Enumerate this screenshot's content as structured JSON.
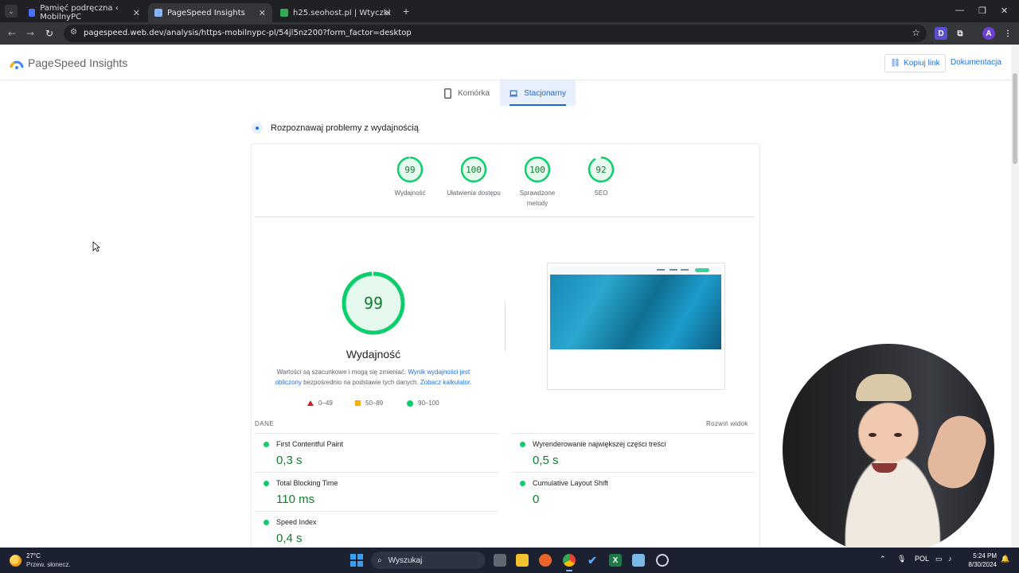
{
  "browser": {
    "tabs": [
      {
        "title": "Pamięć podręczna ‹ MobilnyPC",
        "active": false
      },
      {
        "title": "PageSpeed Insights",
        "active": true
      },
      {
        "title": "h25.seohost.pl | Wtyczki",
        "active": false
      }
    ],
    "url": "pagespeed.web.dev/analysis/https-mobilnypc-pl/54jl5nz200?form_factor=desktop",
    "profile_letter": "A",
    "ext_letter": "D"
  },
  "header": {
    "title": "PageSpeed Insights",
    "copy_link": "Kopiuj link",
    "docs": "Dokumentacja"
  },
  "device_tabs": {
    "mobile": "Komórka",
    "desktop": "Stacjonarny",
    "selected": "desktop"
  },
  "diagnose_heading": "Rozpoznawaj problemy z wydajnością",
  "scores": [
    {
      "value": "99",
      "score": 99,
      "label": "Wydajność"
    },
    {
      "value": "100",
      "score": 100,
      "label": "Ułatwienia dostępu"
    },
    {
      "value": "100",
      "score": 100,
      "label": "Sprawdzone metody"
    },
    {
      "value": "92",
      "score": 92,
      "label": "SEO"
    }
  ],
  "performance": {
    "score": "99",
    "score_value": 99,
    "title": "Wydajność",
    "desc_part1": "Wartości są szacunkowe i mogą się zmieniać. ",
    "desc_link1": "Wynik wydajności jest obliczony",
    "desc_part2": " bezpośrednio na podstawie tych danych. ",
    "desc_link2": "Zobacz kalkulator",
    "desc_part3": "."
  },
  "legend": {
    "bad": "0–49",
    "average": "50–89",
    "good": "90–100"
  },
  "metrics_section": {
    "label": "DANE",
    "expand": "Rozwiń widok"
  },
  "metrics": [
    {
      "name": "First Contentful Paint",
      "value": "0,3 s"
    },
    {
      "name": "Wyrenderowanie największej części treści",
      "value": "0,5 s"
    },
    {
      "name": "Total Blocking Time",
      "value": "110 ms"
    },
    {
      "name": "Cumulative Layout Shift",
      "value": "0"
    },
    {
      "name": "Speed Index",
      "value": "0,4 s"
    }
  ],
  "colors": {
    "pass": "#0cce6b",
    "pass_text": "#0c7f2b",
    "accent": "#1a73e8"
  },
  "taskbar": {
    "temperature": "27°C",
    "weather": "Przew. słonecz.",
    "search": "Wyszukaj",
    "language": "POL",
    "time": "5:24 PM",
    "date": "8/30/2024"
  }
}
